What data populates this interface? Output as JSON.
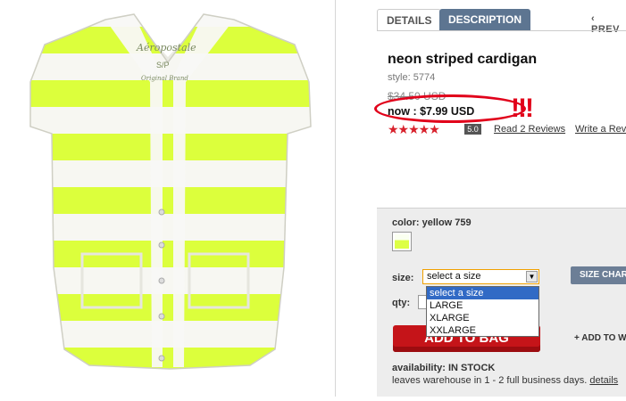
{
  "tabs": [
    {
      "label": "DETAILS"
    },
    {
      "label": "DESCRIPTION"
    }
  ],
  "nav": {
    "prev_label": "‹ PREV"
  },
  "product": {
    "title": "neon striped cardigan",
    "style": "style: 5774",
    "old_price": "$34.50 USD",
    "now_price": "now : $7.99 USD",
    "annotation": "!!!",
    "rating_value": "5.0",
    "stars": "★★★★★",
    "stars_count": 5,
    "read_reviews": "Read 2 Reviews",
    "write_review": "Write a Review",
    "logo_text": "Aéropostale",
    "tag_size": "S/P",
    "tag_sub": "Original Brand",
    "colors": {
      "shirt_neon": "#dcff3c",
      "shirt_white": "#f7f7f2",
      "accent_red": "#e1001a"
    }
  },
  "options": {
    "color_label": "color: yellow 759",
    "size_label": "size:",
    "size_selected": "select a size",
    "size_options": [
      "select a size",
      "LARGE",
      "XLARGE",
      "XXLARGE"
    ],
    "qty_label": "qty:",
    "size_chart": "SIZE CHART",
    "add_to_bag": "ADD TO BAG",
    "add_to_wishlist": "+ ADD TO W"
  },
  "availability": {
    "label": "availability: IN STOCK",
    "leaves": "leaves warehouse in 1 - 2 full business days.",
    "details_link": "details"
  }
}
